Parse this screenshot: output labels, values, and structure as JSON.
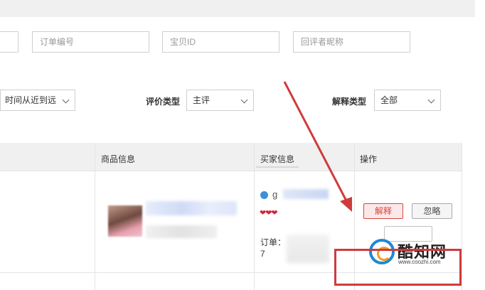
{
  "filters": {
    "order_number_placeholder": "订单编号",
    "item_id_placeholder": "宝贝ID",
    "reviewer_nickname_placeholder": "回评者昵称",
    "sort_value": "时间从近到远",
    "review_type_label": "评价类型",
    "review_type_value": "主评",
    "explain_type_label": "解释类型",
    "explain_type_value": "全部"
  },
  "table": {
    "headers": {
      "product_info": "商品信息",
      "buyer_info": "买家信息",
      "actions": "操作"
    },
    "row": {
      "buyer_name_partial": "g",
      "rating_hearts": "❤❤❤",
      "order_label": "订单：",
      "order_number_partial": "7",
      "explain_button": "解释",
      "ignore_button": "忽略"
    }
  },
  "watermark": {
    "name": "酷知网",
    "url": "www.coozhi.com"
  },
  "colors": {
    "accent_red": "#d9453f",
    "annotation_red": "#cf3b3b",
    "header_bg": "#f0f0f0",
    "watermark_blue": "#1e88d8",
    "watermark_orange": "#f49a1f"
  }
}
